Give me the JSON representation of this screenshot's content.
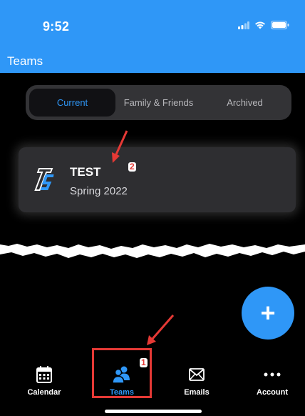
{
  "status_bar": {
    "time": "9:52"
  },
  "header": {
    "title": "Teams"
  },
  "segments": [
    {
      "label": "Current",
      "active": true
    },
    {
      "label": "Family & Friends",
      "active": false
    },
    {
      "label": "Archived",
      "active": false
    }
  ],
  "team": {
    "name": "TEST",
    "season": "Spring 2022",
    "logo_text": "TS"
  },
  "fab": {
    "label": "+"
  },
  "tabs": [
    {
      "label": "Calendar",
      "icon": "calendar-icon",
      "active": false
    },
    {
      "label": "Teams",
      "icon": "people-icon",
      "active": true
    },
    {
      "label": "Emails",
      "icon": "envelope-icon",
      "active": false
    },
    {
      "label": "Account",
      "icon": "ellipsis-icon",
      "active": false
    }
  ],
  "annotations": {
    "badge_1": "1",
    "badge_2": "2"
  },
  "colors": {
    "accent": "#2f97f7",
    "annotation": "#e53935",
    "background": "#000000"
  }
}
